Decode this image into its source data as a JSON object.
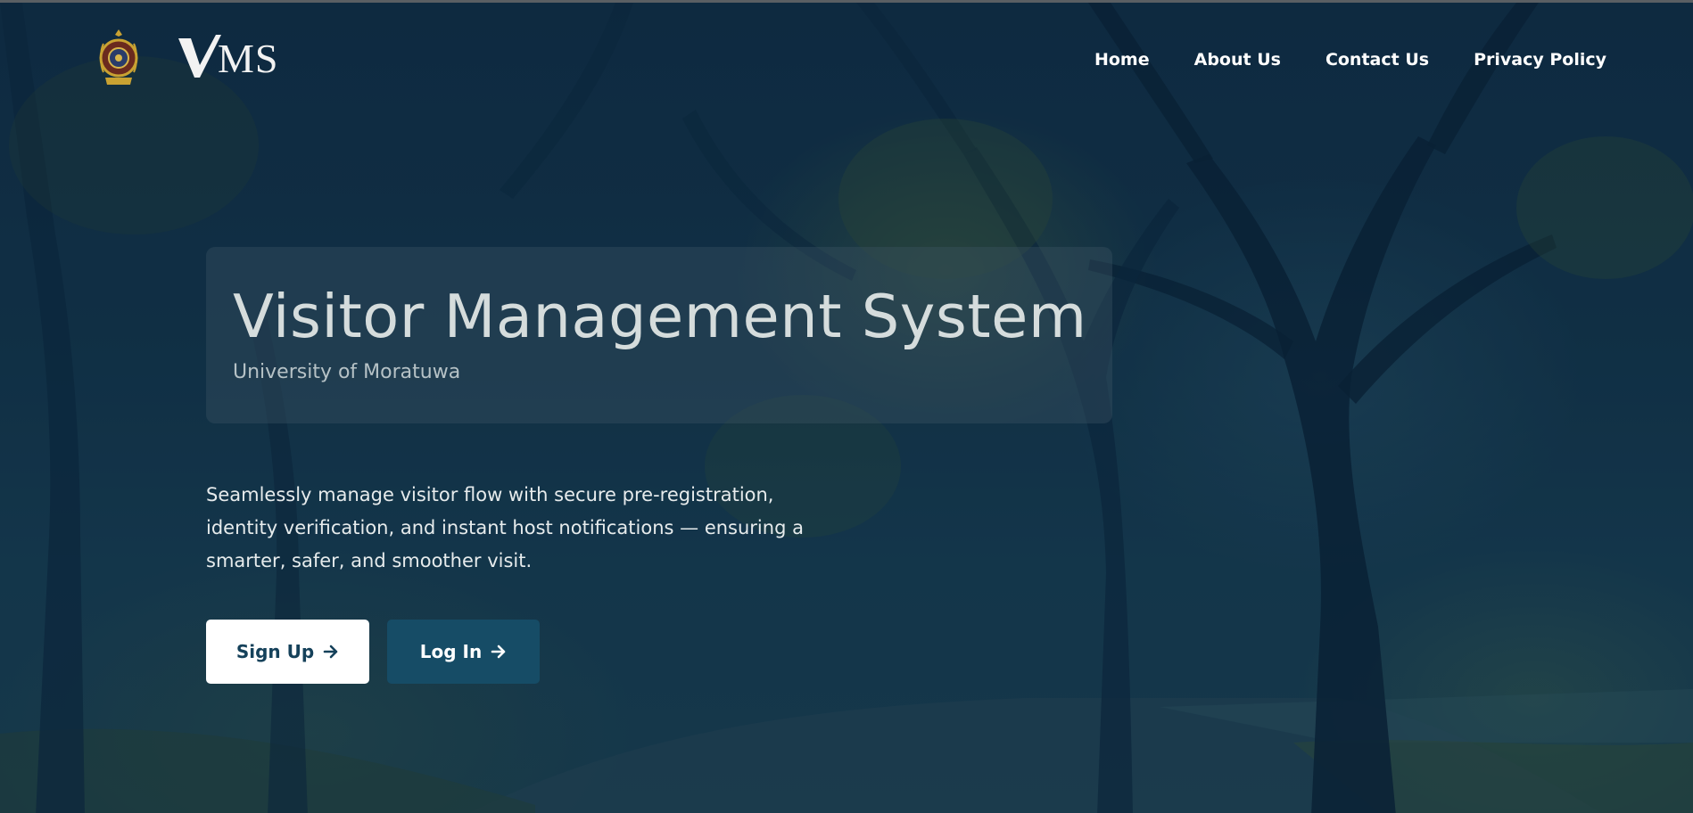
{
  "header": {
    "brand_text": "MS",
    "nav": [
      {
        "label": "Home"
      },
      {
        "label": "About Us"
      },
      {
        "label": "Contact Us"
      },
      {
        "label": "Privacy Policy"
      }
    ]
  },
  "hero": {
    "title": "Visitor Management System",
    "subtitle": "University of Moratuwa",
    "description": "Seamlessly manage visitor flow with secure pre-registration, identity verification, and instant host notifications — ensuring a smarter, safer, and smoother visit.",
    "signup_label": "Sign Up",
    "login_label": "Log In"
  },
  "icons": {
    "crest": "university-crest-icon",
    "arrow": "arrow-right-icon"
  },
  "colors": {
    "background": "#123048",
    "signup_bg": "#ffffff",
    "signup_text": "#15415a",
    "login_bg": "#164c66",
    "title_text": "#d5dcdc"
  }
}
